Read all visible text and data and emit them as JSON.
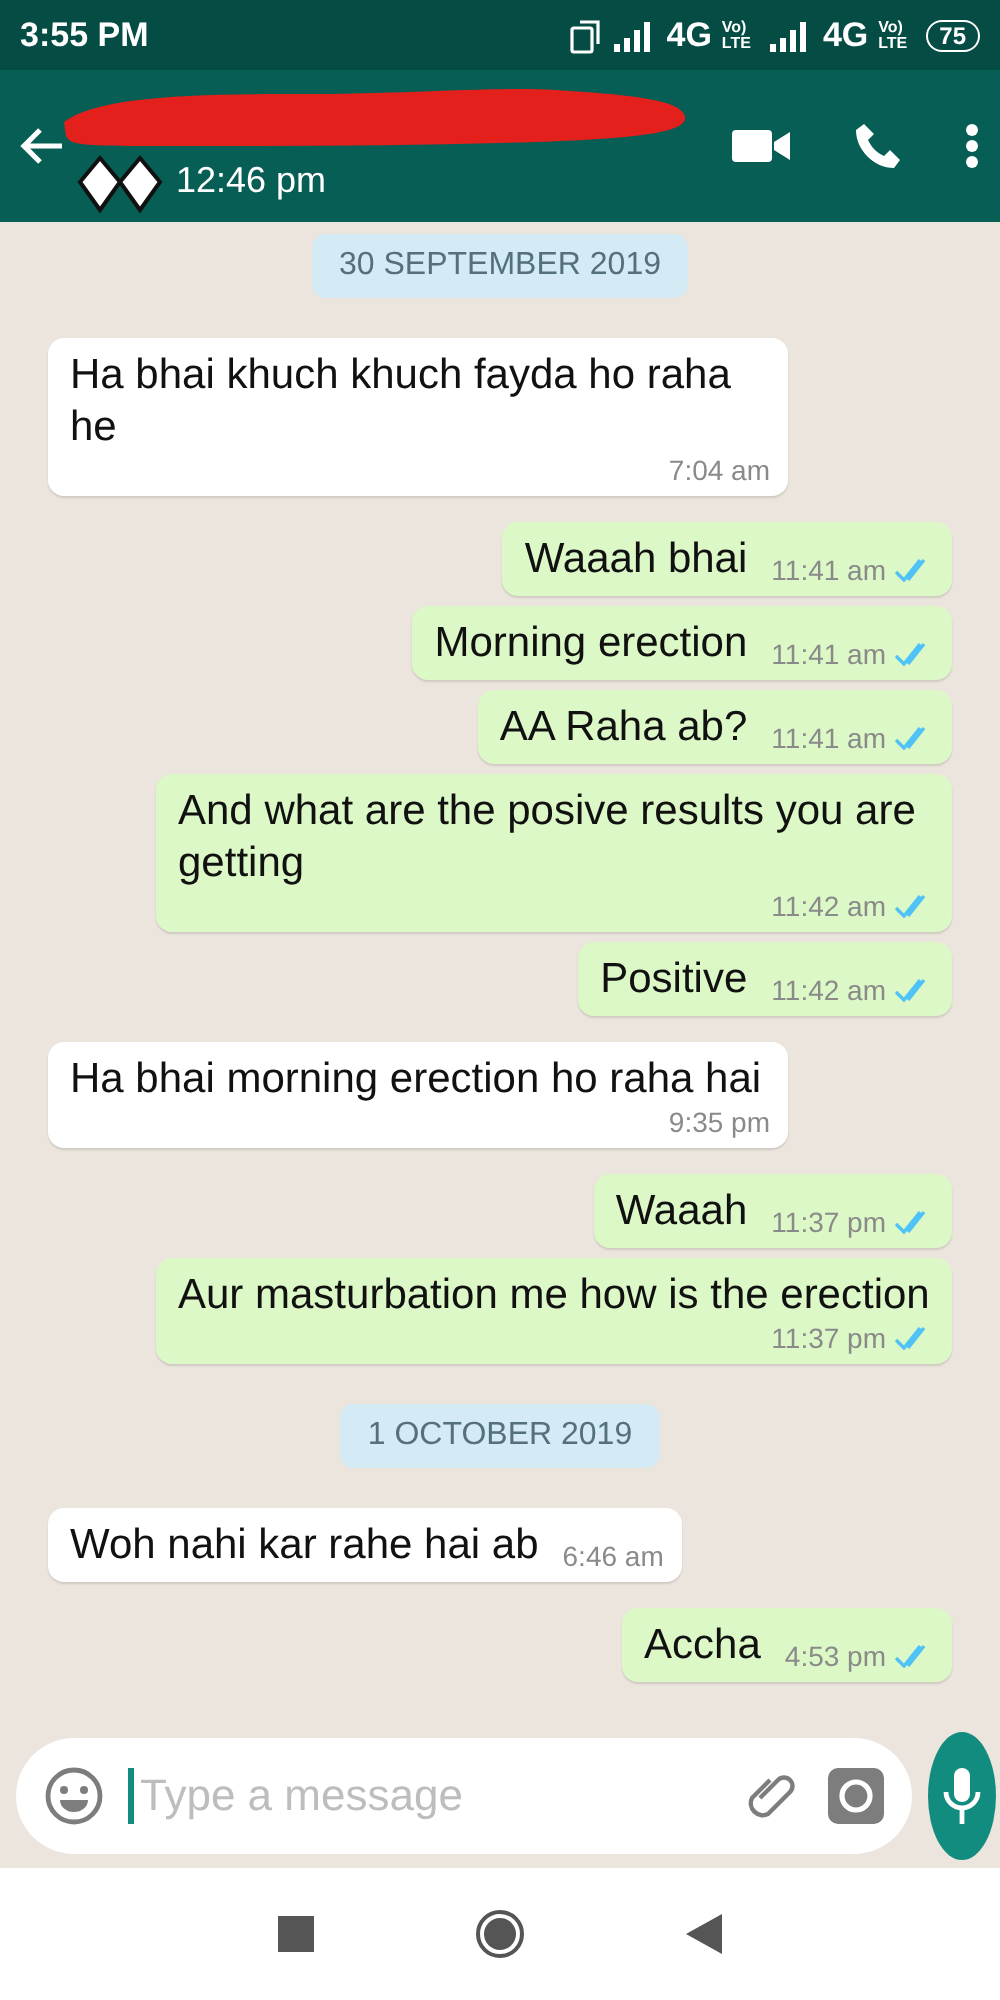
{
  "status_bar": {
    "time": "3:55 PM",
    "networks": [
      {
        "type": "4G",
        "badge_top": "Vo)",
        "badge_bottom": "LTE"
      },
      {
        "type": "4G",
        "badge_top": "Vo)",
        "badge_bottom": "LTE"
      }
    ],
    "battery": "75"
  },
  "header": {
    "last_seen": "12:46 pm",
    "redacted": true
  },
  "messages": [
    {
      "kind": "date",
      "text": "30 SEPTEMBER 2019"
    },
    {
      "kind": "in",
      "text": "Ha bhai khuch khuch fayda ho raha he",
      "time": "7:04 am"
    },
    {
      "kind": "out",
      "text": "Waaah bhai",
      "time": "11:41 am",
      "read": true
    },
    {
      "kind": "out",
      "text": "Morning erection",
      "time": "11:41 am",
      "read": true
    },
    {
      "kind": "out",
      "text": "AA Raha ab?",
      "time": "11:41 am",
      "read": true
    },
    {
      "kind": "out",
      "text": "And what are the posive results you are getting",
      "time": "11:42 am",
      "read": true
    },
    {
      "kind": "out",
      "text": "Positive",
      "time": "11:42 am",
      "read": true
    },
    {
      "kind": "in",
      "text": "Ha bhai morning erection ho raha hai",
      "time": "9:35 pm"
    },
    {
      "kind": "out",
      "text": "Waaah",
      "time": "11:37 pm",
      "read": true
    },
    {
      "kind": "out",
      "text": "Aur masturbation me how is the erection",
      "time": "11:37 pm",
      "read": true
    },
    {
      "kind": "date",
      "text": "1 OCTOBER 2019"
    },
    {
      "kind": "in",
      "text": "Woh nahi kar rahe hai ab",
      "time": "6:46 am"
    },
    {
      "kind": "out",
      "text": "Accha",
      "time": "4:53 pm",
      "read": true
    }
  ],
  "composer": {
    "placeholder": "Type a message"
  }
}
